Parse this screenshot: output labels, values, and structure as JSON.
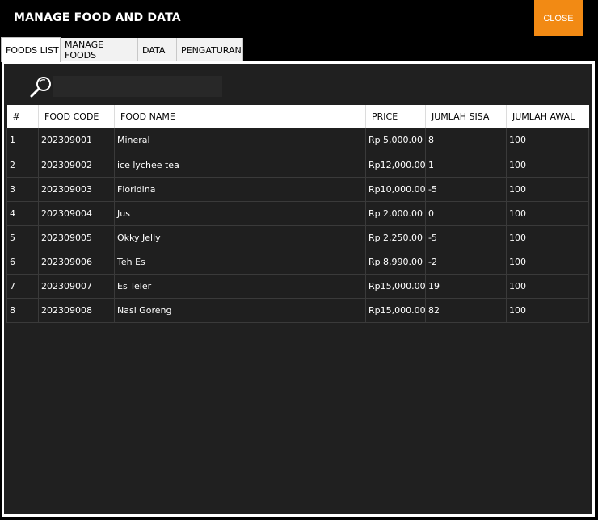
{
  "window": {
    "title": "MANAGE FOOD AND DATA",
    "close_label": "CLOSE"
  },
  "tabs": [
    {
      "label": "FOODS LIST",
      "active": true
    },
    {
      "label": "MANAGE FOODS",
      "active": false
    },
    {
      "label": "DATA",
      "active": false
    },
    {
      "label": "PENGATURAN",
      "active": false
    }
  ],
  "search": {
    "icon": "search-icon",
    "value": "",
    "placeholder": ""
  },
  "table": {
    "columns": [
      "#",
      "FOOD CODE",
      "FOOD NAME",
      "PRICE",
      "JUMLAH SISA",
      "JUMLAH AWAL"
    ],
    "currency": "Rp",
    "rows": [
      {
        "no": "1",
        "code": "202309001",
        "name": "Mineral",
        "price": "5,000.00",
        "sisa": "8",
        "awal": "100"
      },
      {
        "no": "2",
        "code": "202309002",
        "name": "ice lychee tea",
        "price": "12,000.00",
        "sisa": "1",
        "awal": "100"
      },
      {
        "no": "3",
        "code": "202309003",
        "name": "Floridina",
        "price": "10,000.00",
        "sisa": "-5",
        "awal": "100"
      },
      {
        "no": "4",
        "code": "202309004",
        "name": "Jus",
        "price": "2,000.00",
        "sisa": "0",
        "awal": "100"
      },
      {
        "no": "5",
        "code": "202309005",
        "name": "Okky Jelly",
        "price": "2,250.00",
        "sisa": "-5",
        "awal": "100"
      },
      {
        "no": "6",
        "code": "202309006",
        "name": "Teh Es",
        "price": "8,990.00",
        "sisa": "-2",
        "awal": "100"
      },
      {
        "no": "7",
        "code": "202309007",
        "name": "Es Teler",
        "price": "15,000.00",
        "sisa": "19",
        "awal": "100"
      },
      {
        "no": "8",
        "code": "202309008",
        "name": "Nasi Goreng",
        "price": "15,000.00",
        "sisa": "82",
        "awal": "100"
      }
    ]
  },
  "colors": {
    "accent": "#f28a14",
    "panel_bg": "#202020",
    "window_bg": "#000000"
  }
}
